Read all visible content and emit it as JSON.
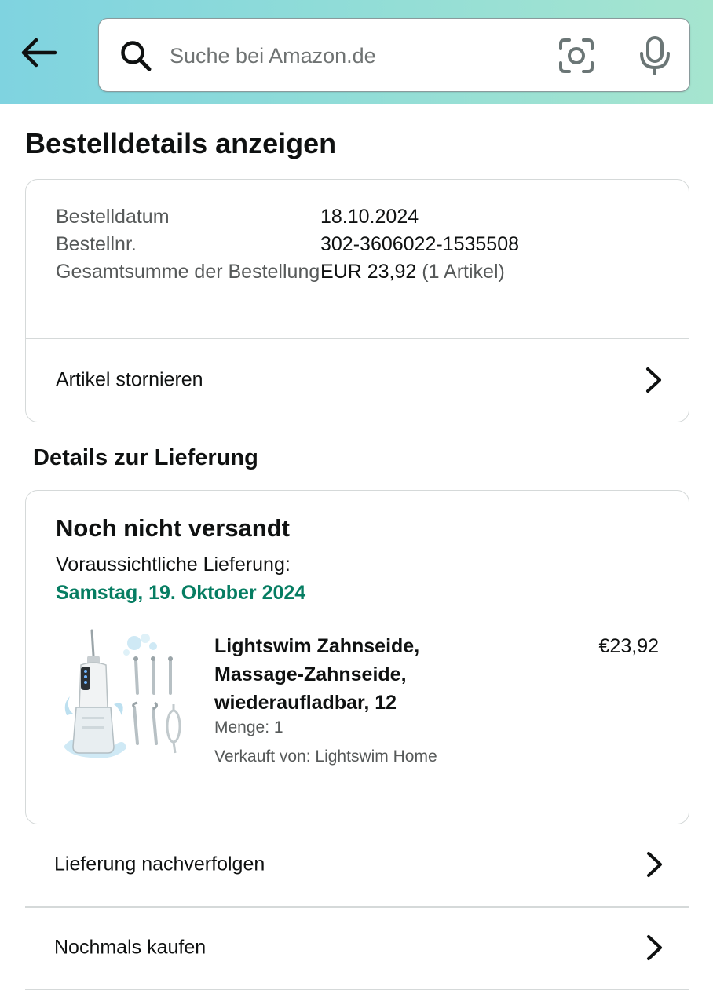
{
  "search": {
    "placeholder": "Suche bei Amazon.de"
  },
  "page": {
    "title": "Bestelldetails anzeigen"
  },
  "order": {
    "date_label": "Bestelldatum",
    "date_value": "18.10.2024",
    "number_label": "Bestellnr.",
    "number_value": "302-3606022-1535508",
    "total_label": "Gesamtsumme der Bestellung",
    "total_value": "EUR 23,92",
    "total_items": "(1 Artikel)",
    "cancel_label": "Artikel stornieren"
  },
  "delivery": {
    "section_title": "Details zur Lieferung",
    "status": "Noch nicht versandt",
    "eta_label": "Voraussichtliche Lieferung:",
    "eta_date": "Samstag, 19. Oktober 2024",
    "item": {
      "name": "Lightswim Zahnseide, Massage-Zahnseide, wiederaufladbar, 12",
      "price": "€23,92",
      "quantity": "Menge: 1",
      "seller": "Verkauft von: Lightswim Home"
    }
  },
  "actions": {
    "track": "Lieferung nachverfolgen",
    "buy_again": "Nochmals kaufen"
  },
  "colors": {
    "header_gradient_start": "#7fd3e0",
    "header_gradient_end": "#a6e5cf",
    "delivery_green": "#067d62",
    "border": "#d5d9d9",
    "text_primary": "#0f1111",
    "text_secondary": "#565959"
  },
  "icons": {
    "back": "arrow-left-icon",
    "search": "magnifier-icon",
    "camera": "camera-scan-icon",
    "mic": "microphone-icon",
    "chevron": "chevron-right-icon"
  }
}
